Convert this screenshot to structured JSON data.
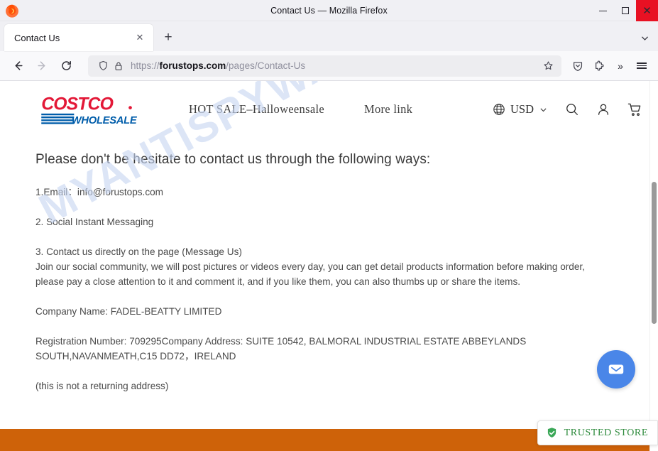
{
  "window": {
    "title": "Contact Us — Mozilla Firefox",
    "minimize_label": "Minimize",
    "maximize_label": "Maximize",
    "close_label": "✕"
  },
  "tabs": {
    "active_tab_title": "Contact Us",
    "close_tab_glyph": "✕",
    "new_tab_glyph": "+",
    "list_all_tabs_glyph": "⌄"
  },
  "toolbar": {
    "back_label": "Back",
    "forward_label": "Forward",
    "reload_label": "Reload",
    "url_protocol": "https://",
    "url_domain": "forustops.com",
    "url_path": "/pages/Contact-Us",
    "bookmark_label": "Bookmark this page",
    "pocket_label": "Save to Pocket",
    "extensions_label": "Extensions",
    "overflow_glyph": "»",
    "menu_label": "Open application menu"
  },
  "site": {
    "logo": {
      "brand": "COSTCO",
      "sub_brand": "WHOLESALE",
      "brand_color": "#E31837",
      "sub_brand_color": "#005DAA"
    },
    "nav": [
      {
        "label": "HOT SALE–Halloweensale"
      },
      {
        "label": "More link"
      }
    ],
    "currency": {
      "value": "USD",
      "chevron": "⌄"
    },
    "icons": {
      "globe": "globe-icon",
      "search": "search-icon",
      "account": "account-icon",
      "cart": "cart-icon"
    }
  },
  "main": {
    "headline": "Please don't be hesitate to contact us through the following ways:",
    "item_email": "1.Email：info@forustops.com",
    "item_social": "2. Social Instant Messaging",
    "item_page": "3. Contact us directly on the page (Message Us)",
    "join_line_1": "Join our social community, we will post pictures or videos every day, you can get detail products information before making order,",
    "join_line_2": "please pay a close attention to it and comment it, and if you like them, you can also thumbs up or share the items.",
    "company_name": "Company Name: FADEL-BEATTY LIMITED",
    "registration_line_1": "Registration Number: 709295Company Address: SUITE 10542, BALMORAL INDUSTRIAL ESTATE ABBEYLANDS",
    "registration_line_2": "SOUTH,NAVANMEATH,C15 DD72，IRELAND",
    "note": "(this is not a returning address)"
  },
  "overlays": {
    "watermark": "MYANTISPYWARE.COM",
    "chat_button_label": "Open chat",
    "trusted_store_label": "TRUSTED STORE",
    "footer_color": "#ce6209",
    "chat_color": "#4a86e8",
    "trusted_color": "#2e8b3d"
  }
}
